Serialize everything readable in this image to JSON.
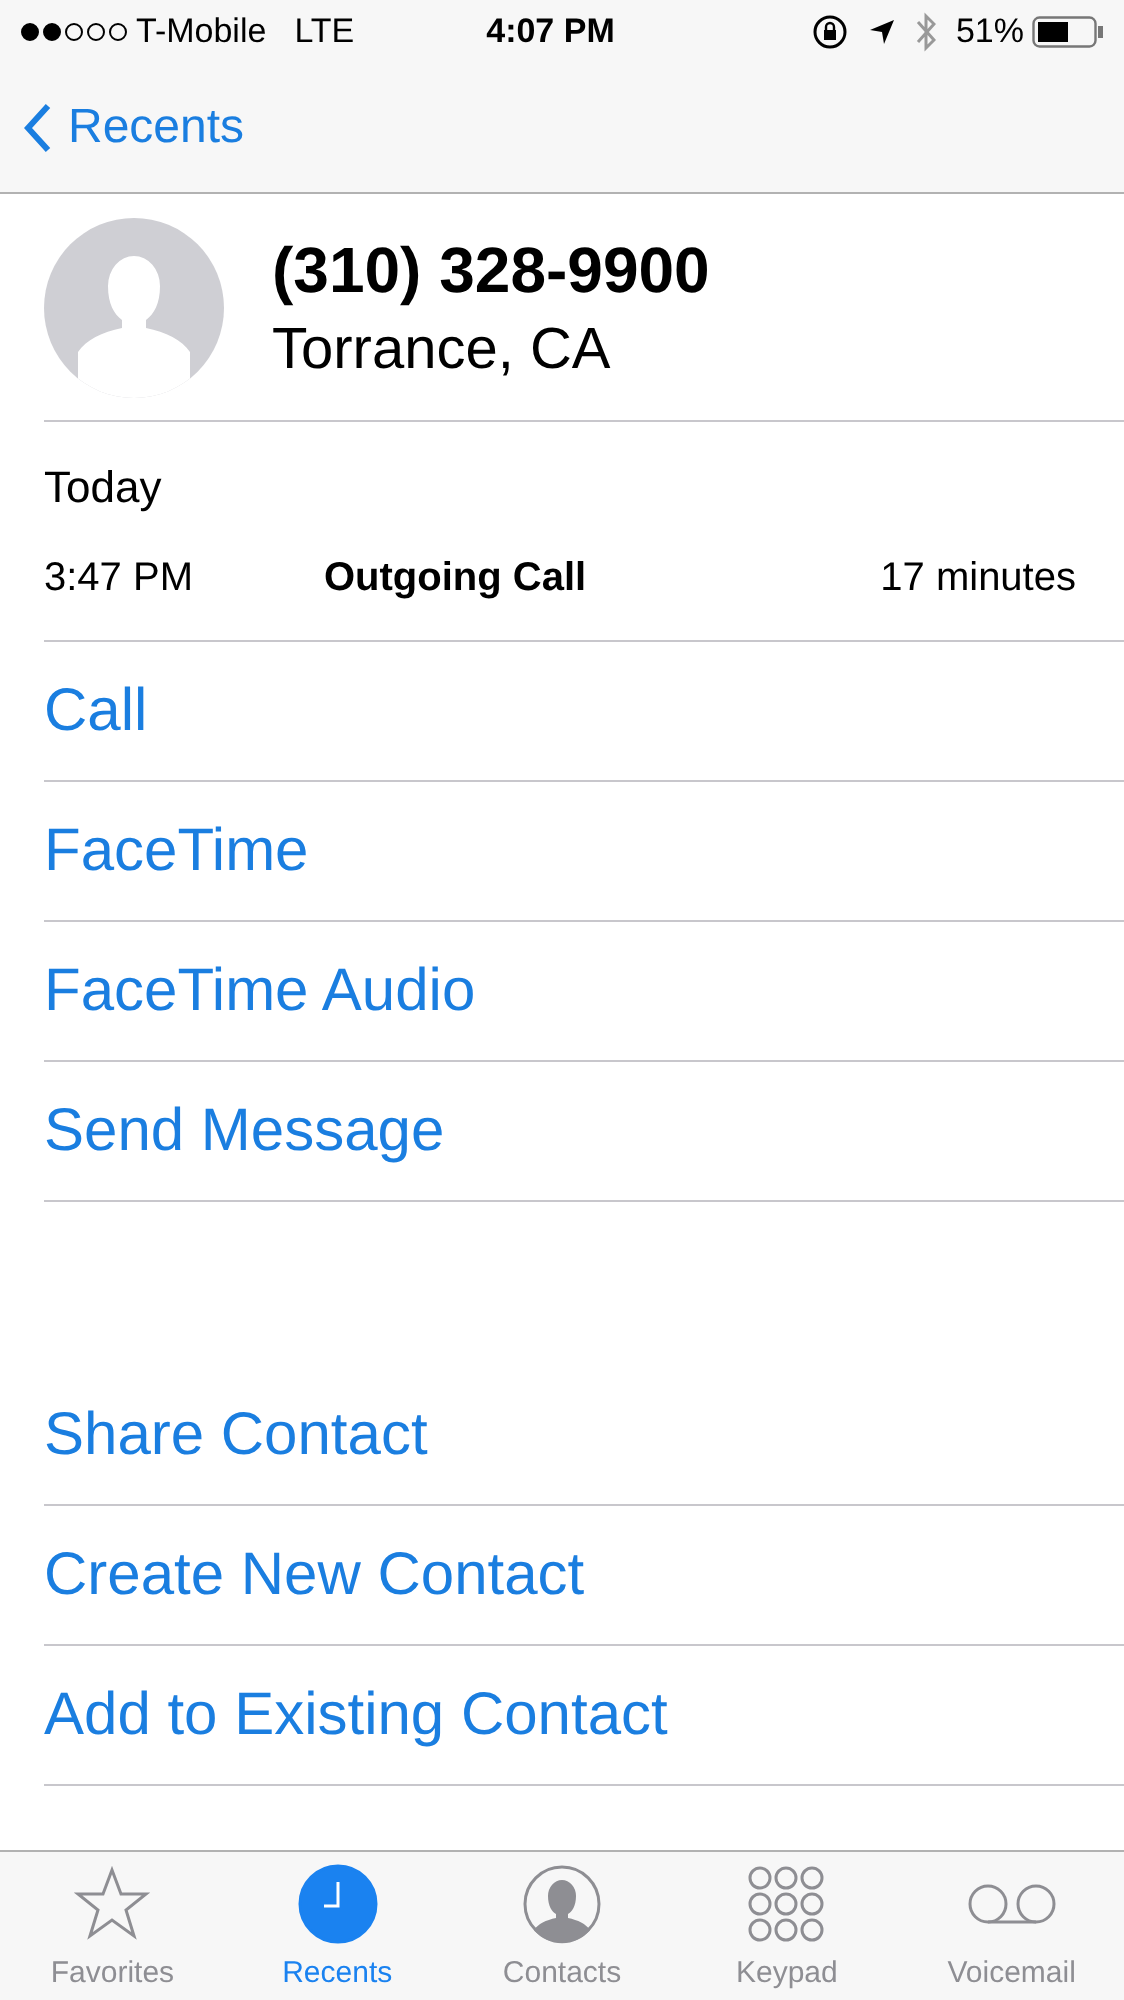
{
  "status_bar": {
    "carrier": "T-Mobile",
    "network": "LTE",
    "time": "4:07 PM",
    "battery": "51%"
  },
  "nav": {
    "back": "Recents"
  },
  "contact": {
    "number": "(310) 328-9900",
    "location": "Torrance, CA"
  },
  "history": {
    "day": "Today",
    "time": "3:47 PM",
    "type": "Outgoing Call",
    "duration": "17 minutes"
  },
  "actions": [
    "Call",
    "FaceTime",
    "FaceTime Audio",
    "Send Message"
  ],
  "contact_actions": [
    "Share Contact",
    "Create New Contact",
    "Add to Existing Contact"
  ],
  "tabs": [
    {
      "label": "Favorites",
      "kind": "star",
      "selected": false
    },
    {
      "label": "Recents",
      "kind": "clock",
      "selected": true
    },
    {
      "label": "Contacts",
      "kind": "person",
      "selected": false
    },
    {
      "label": "Keypad",
      "kind": "keypad",
      "selected": false
    },
    {
      "label": "Voicemail",
      "kind": "voicemail",
      "selected": false
    }
  ]
}
